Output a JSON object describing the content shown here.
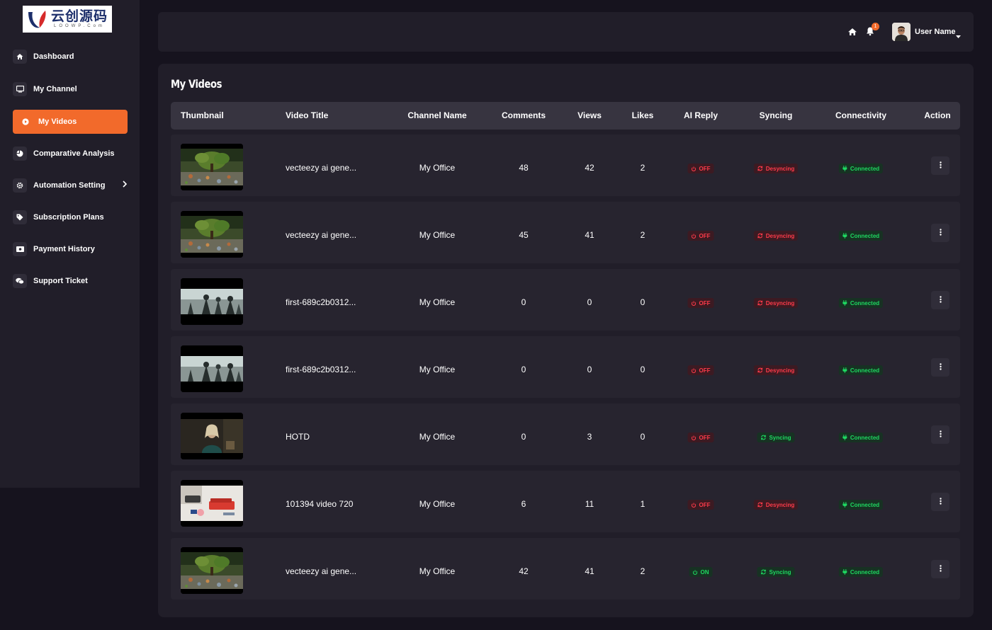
{
  "logo": {
    "text_cn": "云创源码",
    "text_en": "LOOWP.Com"
  },
  "sidebar": {
    "items": [
      {
        "label": "Dashboard",
        "icon": "home-icon"
      },
      {
        "label": "My Channel",
        "icon": "monitor-icon"
      },
      {
        "label": "My Videos",
        "icon": "play-circle-icon",
        "active": true
      },
      {
        "label": "Comparative Analysis",
        "icon": "pie-chart-icon"
      },
      {
        "label": "Automation Setting",
        "icon": "gear-icon",
        "has_submenu": true
      },
      {
        "label": "Subscription Plans",
        "icon": "tag-icon"
      },
      {
        "label": "Payment History",
        "icon": "money-icon"
      },
      {
        "label": "Support Ticket",
        "icon": "chat-icon"
      }
    ]
  },
  "header": {
    "notification_count": "1",
    "user_name": "User Name"
  },
  "main": {
    "title": "My Videos",
    "columns": [
      "Thumbnail",
      "Video Title",
      "Channel Name",
      "Comments",
      "Views",
      "Likes",
      "AI Reply",
      "Syncing",
      "Connectivity",
      "Action"
    ],
    "rows": [
      {
        "thumb": "forest",
        "title": "vecteezy ai gene...",
        "channel": "My Office",
        "comments": "48",
        "views": "42",
        "likes": "2",
        "ai_reply": "OFF",
        "syncing": "Desyncing",
        "connectivity": "Connected"
      },
      {
        "thumb": "forest",
        "title": "vecteezy ai gene...",
        "channel": "My Office",
        "comments": "45",
        "views": "41",
        "likes": "2",
        "ai_reply": "OFF",
        "syncing": "Desyncing",
        "connectivity": "Connected"
      },
      {
        "thumb": "battle",
        "title": "first-689c2b0312...",
        "channel": "My Office",
        "comments": "0",
        "views": "0",
        "likes": "0",
        "ai_reply": "OFF",
        "syncing": "Desyncing",
        "connectivity": "Connected"
      },
      {
        "thumb": "battle",
        "title": "first-689c2b0312...",
        "channel": "My Office",
        "comments": "0",
        "views": "0",
        "likes": "0",
        "ai_reply": "OFF",
        "syncing": "Desyncing",
        "connectivity": "Connected"
      },
      {
        "thumb": "portrait",
        "title": "HOTD",
        "channel": "My Office",
        "comments": "0",
        "views": "3",
        "likes": "0",
        "ai_reply": "OFF",
        "syncing": "Syncing",
        "connectivity": "Connected"
      },
      {
        "thumb": "desk",
        "title": "101394 video 720",
        "channel": "My Office",
        "comments": "6",
        "views": "11",
        "likes": "1",
        "ai_reply": "OFF",
        "syncing": "Desyncing",
        "connectivity": "Connected"
      },
      {
        "thumb": "forest",
        "title": "vecteezy ai gene...",
        "channel": "My Office",
        "comments": "42",
        "views": "41",
        "likes": "2",
        "ai_reply": "ON",
        "syncing": "Syncing",
        "connectivity": "Connected"
      }
    ]
  },
  "colors": {
    "accent": "#f26a2b",
    "status_red": "#ff3b4a",
    "status_green": "#1ed760"
  }
}
